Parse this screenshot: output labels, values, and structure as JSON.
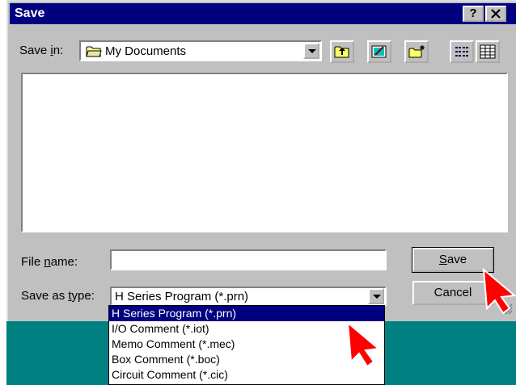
{
  "title": "Save",
  "title_buttons": {
    "help": "?",
    "close": "X"
  },
  "save_in": {
    "label_prefix": "Save ",
    "label_mnemonic": "i",
    "label_suffix": "n:",
    "value": "My Documents"
  },
  "toolbar": {
    "icons": [
      "up-one-level-icon",
      "desktop-icon",
      "create-new-folder-icon",
      "list-view-icon",
      "details-view-icon"
    ]
  },
  "file_name": {
    "label_prefix": "File ",
    "label_mnemonic": "n",
    "label_suffix": "ame:",
    "value": ""
  },
  "save_as_type": {
    "label_prefix": "Save as ",
    "label_mnemonic": "t",
    "label_suffix": "ype:",
    "value": "H Series Program (*.prn)",
    "options": [
      "H Series Program (*.prn)",
      "I/O Comment (*.iot)",
      "Memo Comment (*.mec)",
      "Box Comment (*.boc)",
      "Circuit Comment (*.cic)"
    ],
    "selected_index": 0
  },
  "buttons": {
    "save_mnemonic": "S",
    "save_rest": "ave",
    "cancel": "Cancel"
  },
  "colors": {
    "face": "#c0c0c0",
    "title_bar": "#000080",
    "desktop": "#008080",
    "annotation_arrow": "#ff0000"
  }
}
